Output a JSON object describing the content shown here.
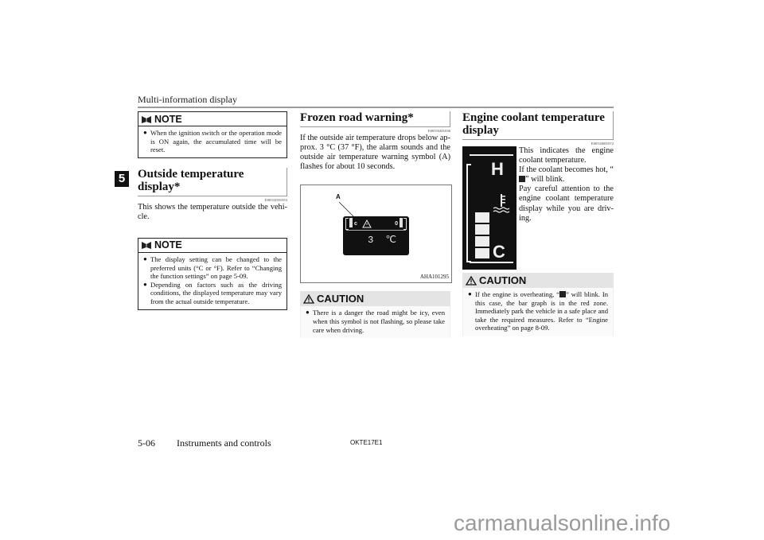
{
  "header": {
    "running_title": "Multi-information display",
    "chapter_number": "5"
  },
  "column1": {
    "note1": {
      "label": "NOTE",
      "items": [
        "When the ignition switch or the operation mode is ON again, the accumulated time will be reset."
      ]
    },
    "section": {
      "title": "Outside temperature display*",
      "code": "E00533501053",
      "body": "This shows the temperature outside the vehi-cle."
    },
    "note2": {
      "label": "NOTE",
      "items": [
        "The display setting can be changed to the preferred units (°C or °F). Refer to “Changing the function settings” on page 5-09.",
        "Depending on factors such as the driving conditions, the displayed temperature may vary from the actual outside temperature."
      ]
    }
  },
  "column2": {
    "section": {
      "title": "Frozen road warning*",
      "code": "E00533401036",
      "body": "If the outside air temperature drops below ap-prox. 3 °C (37 °F), the alarm sounds and the outside air temperature warning symbol (A) flashes for about 10 seconds."
    },
    "figure": {
      "callout": "A",
      "display_temp": "3 ℃",
      "left_label": "c",
      "right_label": "0",
      "code": "AHA101295"
    },
    "caution": {
      "label": "CAUTION",
      "items": [
        "There is a danger the road might be icy, even when this symbol is not flashing, so please take care when driving."
      ]
    }
  },
  "column3": {
    "section": {
      "title": "Engine coolant temperature display",
      "code": "E00533801072",
      "body_parts": [
        "This indicates the engine coolant temperature.",
        "If the coolant becomes hot, “",
        "” will blink.",
        "Pay careful attention to the engine coolant temperature display while you are driv-ing."
      ]
    },
    "gauge": {
      "high_label": "H",
      "low_label": "C",
      "level_segments_lit": 4
    },
    "caution": {
      "label": "CAUTION",
      "items": [
        "If the engine is overheating, “",
        "” will blink. In this case, the bar graph is in the red zone. Immediately park the vehicle in a safe place and take the required measures. Refer to “Engine overheating” on page 8-09."
      ]
    }
  },
  "footer": {
    "page": "5-06",
    "title": "Instruments and controls",
    "code": "OKTE17E1"
  },
  "watermark": "carmanualsonline.info"
}
